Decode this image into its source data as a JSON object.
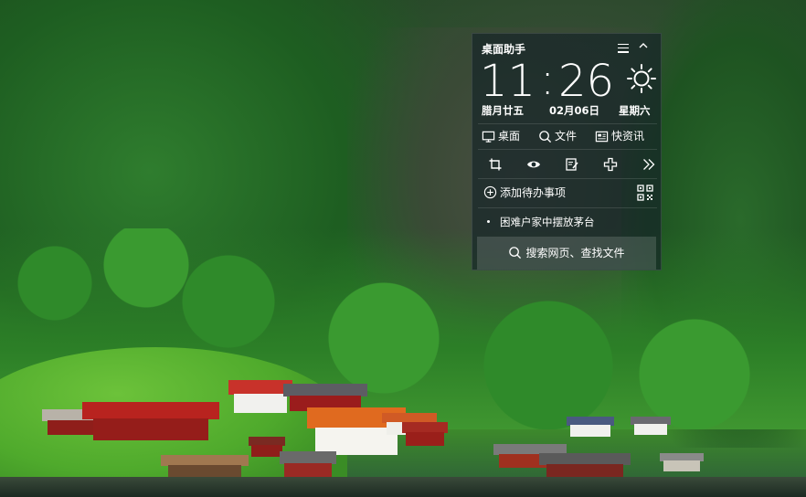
{
  "widget": {
    "title": "桌面助手",
    "clock": {
      "hour": "11",
      "colon": ":",
      "minute": "26"
    },
    "lunar_date": "腊月廿五",
    "date": "02月06日",
    "weekday": "星期六",
    "weather_icon": "sun-icon",
    "quick_links": [
      {
        "label": "桌面",
        "icon": "monitor-icon"
      },
      {
        "label": "文件",
        "icon": "search-icon"
      },
      {
        "label": "快资讯",
        "icon": "news-icon"
      }
    ],
    "tools": [
      "crop-icon",
      "eye-icon",
      "edit-icon",
      "puzzle-icon",
      "double-chevron-right-icon"
    ],
    "todo_label": "添加待办事项",
    "news_item": "困难户家中摆放茅台",
    "search_placeholder": "搜索网页、查找文件"
  },
  "colors": {
    "panel_bg": "#16262880",
    "text": "#ffffff"
  }
}
